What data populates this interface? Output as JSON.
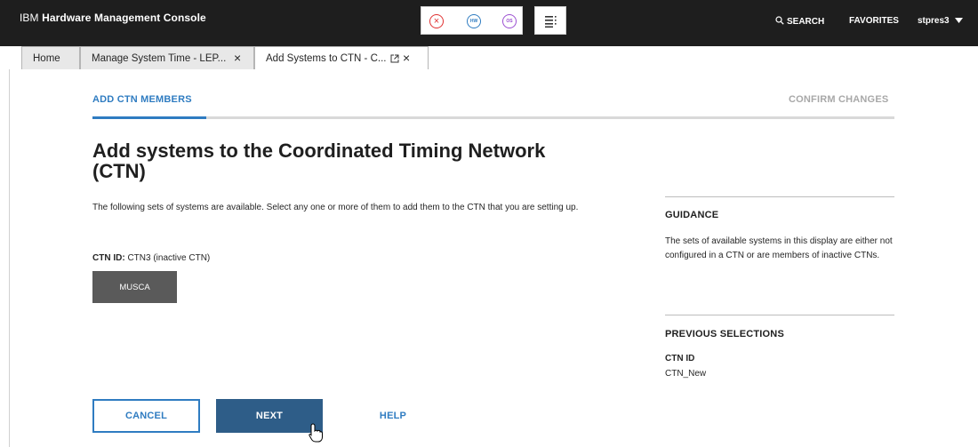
{
  "header": {
    "brand_prefix": "IBM",
    "brand_name": "Hardware Management Console",
    "icons": [
      "close-circle-icon",
      "hw-icon",
      "os-icon",
      "task-list-icon"
    ],
    "hw_label": "HW",
    "os_label": "OS",
    "search_label": "SEARCH",
    "favorites_label": "FAVORITES",
    "user": "stpres3"
  },
  "tabs": [
    {
      "label": "Home"
    },
    {
      "label": "Manage System Time - LEP..."
    },
    {
      "label": "Add Systems to CTN - C..."
    }
  ],
  "steps": {
    "current": "ADD CTN MEMBERS",
    "next": "CONFIRM CHANGES"
  },
  "main": {
    "title": "Add systems to the Coordinated Timing Network (CTN)",
    "description": "The following sets of systems are available. Select any one or more of them to add them to the CTN that you are setting up.",
    "ctn_id_label": "CTN ID:",
    "ctn_id_value": "CTN3 (inactive CTN)",
    "system_button": "MUSCA"
  },
  "sidebar": {
    "guidance_title": "GUIDANCE",
    "guidance_text": "The sets of available systems in this display are either not configured in a CTN or are members of inactive CTNs.",
    "previous_title": "PREVIOUS SELECTIONS",
    "previous_label": "CTN ID",
    "previous_value": "CTN_New"
  },
  "actions": {
    "cancel": "CANCEL",
    "next": "NEXT",
    "help": "HELP"
  },
  "colors": {
    "accent": "#2f7cc1",
    "primary_button": "#2e5d88",
    "topbar": "#1e1e1e",
    "system_button": "#5a5a5a"
  }
}
